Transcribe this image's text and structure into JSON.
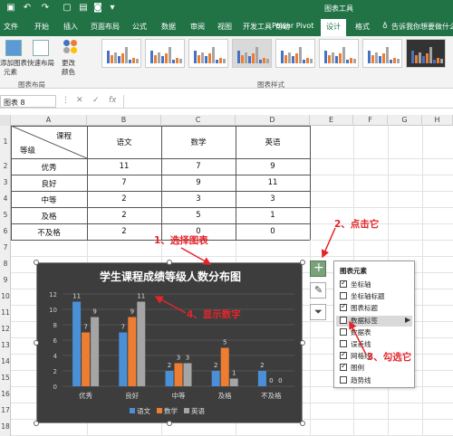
{
  "quick_access": {
    "chart_tools": "图表工具"
  },
  "tabs": [
    "文件",
    "开始",
    "插入",
    "页面布局",
    "公式",
    "数据",
    "审阅",
    "视图",
    "开发工具",
    "帮助",
    "Power Pivot",
    "设计",
    "格式"
  ],
  "tell_me": "告诉我你想要做什么",
  "ribbon": {
    "add_element": "添加图表",
    "add_element_2": "元素",
    "quick_layout": "快速布局",
    "change_colors": "更改",
    "change_colors_2": "颜色",
    "group_layout": "图表布局",
    "group_styles": "图表样式"
  },
  "formula_bar": {
    "name_box": "图表 8",
    "fx": "fx"
  },
  "columns": [
    "A",
    "B",
    "C",
    "D",
    "E",
    "F",
    "G",
    "H"
  ],
  "rows": [
    "1",
    "2",
    "3",
    "4",
    "5",
    "6",
    "7",
    "8",
    "9",
    "10",
    "11",
    "12",
    "13",
    "14",
    "15",
    "16",
    "17",
    "18",
    "19"
  ],
  "table": {
    "corner_top": "课程",
    "corner_bottom": "等级",
    "headers": [
      "语文",
      "数学",
      "英语"
    ],
    "rows": [
      {
        "label": "优秀",
        "v": [
          "11",
          "7",
          "9"
        ]
      },
      {
        "label": "良好",
        "v": [
          "7",
          "9",
          "11"
        ]
      },
      {
        "label": "中等",
        "v": [
          "2",
          "3",
          "3"
        ]
      },
      {
        "label": "及格",
        "v": [
          "2",
          "5",
          "1"
        ]
      },
      {
        "label": "不及格",
        "v": [
          "2",
          "0",
          "0"
        ]
      }
    ]
  },
  "chart_data": {
    "type": "bar",
    "title": "学生课程成绩等级人数分布图",
    "categories": [
      "优秀",
      "良好",
      "中等",
      "及格",
      "不及格"
    ],
    "series": [
      {
        "name": "语文",
        "values": [
          11,
          7,
          2,
          2,
          2
        ],
        "color": "#4a90d9"
      },
      {
        "name": "数学",
        "values": [
          7,
          9,
          3,
          5,
          0
        ],
        "color": "#ed7d31"
      },
      {
        "name": "英语",
        "values": [
          9,
          11,
          3,
          1,
          0
        ],
        "color": "#a5a5a5"
      }
    ],
    "ylim": [
      0,
      12
    ],
    "y_ticks": [
      "0",
      "2",
      "4",
      "6",
      "8",
      "10",
      "12"
    ],
    "legend": "bottom",
    "data_labels": true,
    "grid": true
  },
  "elements_panel": {
    "title": "图表元素",
    "items": [
      {
        "label": "坐标轴",
        "checked": true
      },
      {
        "label": "坐标轴标题",
        "checked": false
      },
      {
        "label": "图表标题",
        "checked": true
      },
      {
        "label": "数据标签",
        "checked": false
      },
      {
        "label": "数据表",
        "checked": false
      },
      {
        "label": "误差线",
        "checked": false
      },
      {
        "label": "网格线",
        "checked": true
      },
      {
        "label": "图例",
        "checked": true
      },
      {
        "label": "趋势线",
        "checked": false
      }
    ]
  },
  "annotations": {
    "a1": "1、选择图表",
    "a2": "2、点击它",
    "a3": "3、勾选它",
    "a4": "4、显示数字"
  }
}
